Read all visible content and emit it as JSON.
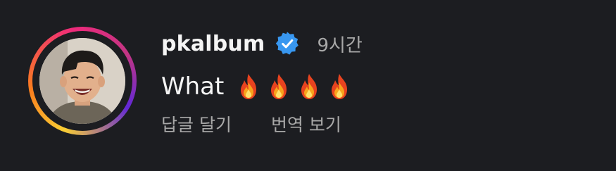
{
  "comment": {
    "username": "pkalbum",
    "verified": true,
    "timestamp": "9시간",
    "text": "What",
    "emoji": [
      "fire-emoji",
      "fire-emoji",
      "fire-emoji",
      "fire-emoji"
    ],
    "actions": {
      "reply": "답글 달기",
      "translate": "번역 보기"
    }
  },
  "colors": {
    "background": "#1c1d21",
    "username": "#f5f5f5",
    "secondary_text": "#a8a8a8",
    "verified_badge": "#3897f0"
  },
  "icons": {
    "verified": "verified-badge-icon",
    "emoji": "fire-emoji"
  }
}
